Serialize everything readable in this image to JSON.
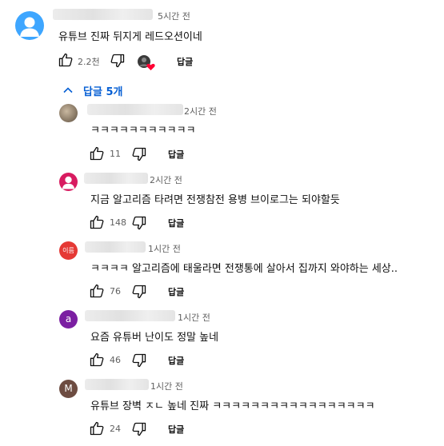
{
  "top_comment": {
    "time": "5시간 전",
    "text": "유튜브 진짜 뒤지게 레드오션이네",
    "like_count": "2.2천",
    "reply_label": "답글"
  },
  "replies_toggle": {
    "label": "답글 5개"
  },
  "replies": [
    {
      "avatar_text": "",
      "time": "2시간 전",
      "text": "ㅋㅋㅋㅋㅋㅋㅋㅋㅋㅋㅋ",
      "like_count": "11",
      "reply_label": "답글"
    },
    {
      "avatar_text": "",
      "time": "2시간 전",
      "text": "지금 알고리즘 타려면 전쟁참전 용병 브이로그는 되야할듯",
      "like_count": "148",
      "reply_label": "답글"
    },
    {
      "avatar_text": "이름",
      "time": "1시간 전",
      "text": "ㅋㅋㅋㅋ 알고리즘에 태울라면 전쟁통에 살아서 집까지 와야하는 세상..",
      "like_count": "76",
      "reply_label": "답글"
    },
    {
      "avatar_text": "a",
      "time": "1시간 전",
      "text": "요즘 유튜버 난이도 정말 높네",
      "like_count": "46",
      "reply_label": "답글"
    },
    {
      "avatar_text": "M",
      "time": "1시간 전",
      "text": "유튜브 장벽 ㅈㄴ 높네 진짜 ㅋㅋㅋㅋㅋㅋㅋㅋㅋㅋㅋㅋㅋㅋㅋㅋㅋ",
      "like_count": "24",
      "reply_label": "답글"
    }
  ],
  "colors": {
    "link_blue": "#065fd4",
    "heart_red": "#ff0033",
    "avatar_default": "#3ea6ff",
    "avatar_pink": "#d81b60",
    "avatar_red": "#e53935",
    "avatar_purple": "#7b1fa2",
    "avatar_brown": "#6d4c41"
  },
  "icons": [
    "user-silhouette-icon",
    "thumbs-up-icon",
    "thumbs-down-icon",
    "creator-heart-icon",
    "chevron-up-icon"
  ]
}
